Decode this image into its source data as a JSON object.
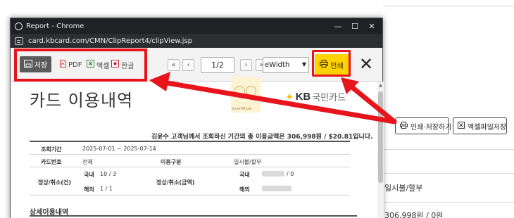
{
  "window": {
    "title": "Report - Chrome",
    "url": "card.kbcard.com/CMN/ClipReport4/clipView.jsp"
  },
  "toolbar": {
    "save_label": "저장",
    "pdf_label": "PDF",
    "excel_label": "엑셀",
    "hangul_label": "한글",
    "page_value": "1/2",
    "zoom_value": "eWidth",
    "print_label": "인쇄"
  },
  "report": {
    "title": "카드 이용내역",
    "logo_kb": "KB",
    "logo_kr": "국민카드",
    "watermark_label": "SmartMLab",
    "summary": "김윤수 고객님께서 조회하신 기간의 총 이용금액은 306,998원 / $20.81입니다.",
    "rows": {
      "period_label": "조회기간",
      "period_value": "2025-07-01 ~ 2025-07-14",
      "card_label": "카드번호",
      "card_value": "전체",
      "usage_type_label": "이용구분",
      "usage_type_value": "일시불/할부",
      "normal_cancel_count_label": "정상/취소(건)",
      "domestic_label": "국내",
      "domestic_count": "10 / 3",
      "overseas_label": "해외",
      "overseas_count": "1 / 1",
      "normal_cancel_amount_label": "정상/취소(금액)",
      "domestic_amount_label": "국내",
      "domestic_amount_suffix": "/ 0",
      "overseas_amount_label": "해외"
    },
    "detail_title": "상세이용내역"
  },
  "background": {
    "print_save_label": "인쇄·저장하기",
    "excel_save_label": "엑셀파일저장",
    "usage_type_value": "일시불/할부",
    "amount_value": "306,998원 / 0원"
  },
  "colors": {
    "highlight": "#e8141b",
    "print_button": "#ffd200",
    "save_button": "#5a5a5a",
    "titlebar": "#202124"
  }
}
